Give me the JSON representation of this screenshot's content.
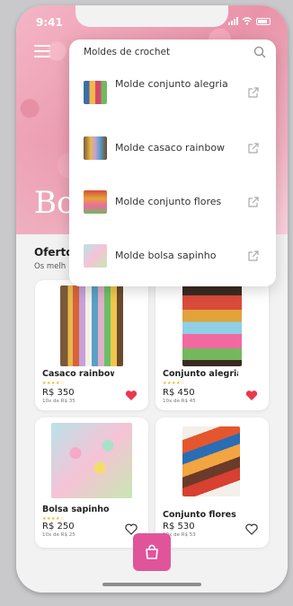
{
  "status_bar": {
    "time": "9:41"
  },
  "hero": {
    "title": "Bo"
  },
  "section": {
    "title": "Oferto",
    "subtitle": "Os melh"
  },
  "search": {
    "value": "Moldes de crochet",
    "results": [
      {
        "label": "Molde conjunto alegria"
      },
      {
        "label": "Molde casaco rainbow"
      },
      {
        "label": "Molde conjunto flores"
      },
      {
        "label": "Molde bolsa sapinho"
      }
    ]
  },
  "products": [
    {
      "name": "Casaco rainbow",
      "stars": "★★★★☆",
      "price": "R$ 350",
      "installments": "10x de R$ 35",
      "favorite": true
    },
    {
      "name": "Conjunto alegria",
      "stars": "★★★★☆",
      "price": "R$ 450",
      "installments": "10x de R$ 45",
      "favorite": true
    },
    {
      "name": "Bolsa sapinho",
      "stars": "★★★★☆",
      "price": "R$ 250",
      "installments": "10x de R$ 25",
      "favorite": false
    },
    {
      "name": "Conjunto flores",
      "stars": "",
      "price": "R$ 530",
      "installments": "10x de R$ 53",
      "favorite": false
    }
  ],
  "colors": {
    "accent": "#e0559a",
    "heart": "#e63950",
    "star": "#e8b923"
  },
  "icons": {
    "menu": "menu-icon",
    "search": "search-icon",
    "link": "external-link-icon",
    "heart": "heart-icon",
    "bag": "shopping-bag-icon"
  }
}
